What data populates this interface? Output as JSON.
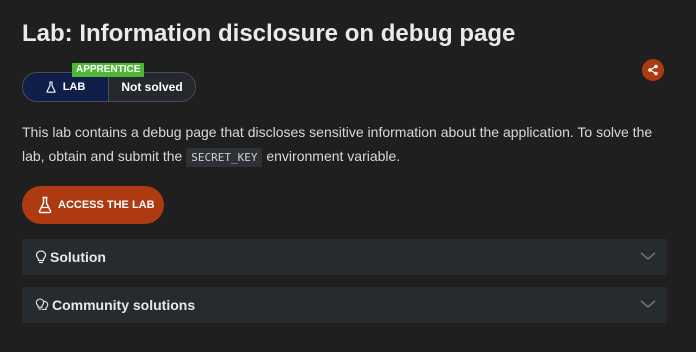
{
  "header": {
    "title": "Lab: Information disclosure on debug page"
  },
  "status": {
    "level": "APPRENTICE",
    "lab_label": "LAB",
    "solved_text": "Not solved"
  },
  "description": {
    "part1": "This lab contains a debug page that discloses sensitive information about the application. To solve the lab, obtain and submit the",
    "code": "SECRET_KEY",
    "part2": "environment variable."
  },
  "access_button": {
    "label": "ACCESS THE LAB"
  },
  "accordions": [
    {
      "label": "Solution",
      "icon": "lightbulb-icon"
    },
    {
      "label": "Community solutions",
      "icon": "lightbulbs-icon"
    }
  ],
  "colors": {
    "background": "#1f1f1f",
    "accent": "#ae3a12",
    "level_badge": "#4fb636",
    "lab_badge": "#0f1f4a",
    "panel": "#262b30"
  },
  "icons": {
    "share": "share-icon",
    "flask": "flask-icon",
    "chevron": "chevron-down-icon"
  }
}
